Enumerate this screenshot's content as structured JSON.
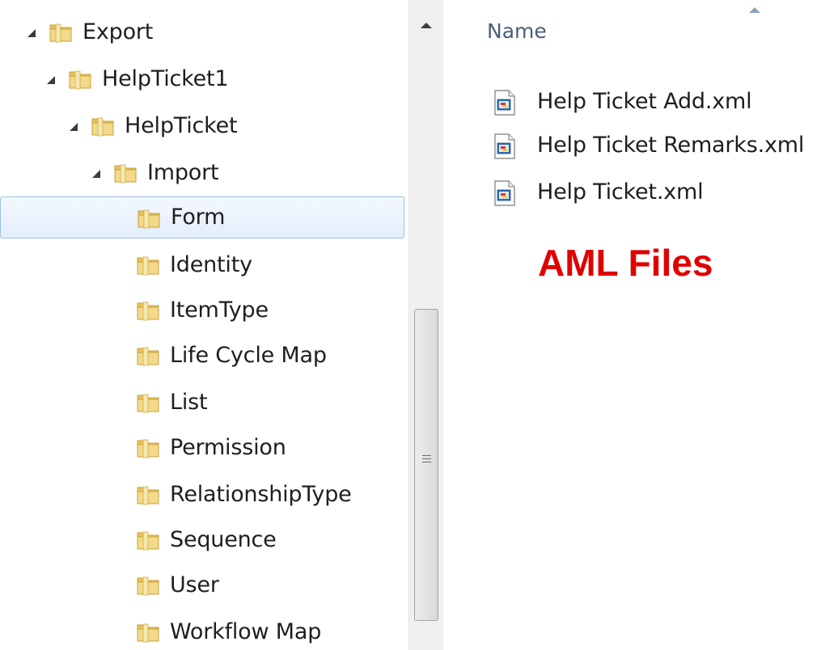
{
  "tree": {
    "items": [
      {
        "label": "Export",
        "expanded": true,
        "selected": false,
        "icon": "folder-icon"
      },
      {
        "label": "HelpTicket1",
        "expanded": true,
        "selected": false,
        "icon": "folder-icon"
      },
      {
        "label": "HelpTicket",
        "expanded": true,
        "selected": false,
        "icon": "folder-icon"
      },
      {
        "label": "Import",
        "expanded": true,
        "selected": false,
        "icon": "folder-icon"
      },
      {
        "label": "Form",
        "expanded": false,
        "selected": true,
        "icon": "folder-icon"
      },
      {
        "label": "Identity",
        "expanded": false,
        "selected": false,
        "icon": "folder-icon"
      },
      {
        "label": "ItemType",
        "expanded": false,
        "selected": false,
        "icon": "folder-icon"
      },
      {
        "label": "Life Cycle Map",
        "expanded": false,
        "selected": false,
        "icon": "folder-icon"
      },
      {
        "label": "List",
        "expanded": false,
        "selected": false,
        "icon": "folder-icon"
      },
      {
        "label": "Permission",
        "expanded": false,
        "selected": false,
        "icon": "folder-icon"
      },
      {
        "label": "RelationshipType",
        "expanded": false,
        "selected": false,
        "icon": "folder-icon"
      },
      {
        "label": "Sequence",
        "expanded": false,
        "selected": false,
        "icon": "folder-icon"
      },
      {
        "label": "User",
        "expanded": false,
        "selected": false,
        "icon": "folder-icon"
      },
      {
        "label": "Workflow Map",
        "expanded": false,
        "selected": false,
        "icon": "folder-icon"
      }
    ]
  },
  "file_list": {
    "column_header": "Name",
    "sort_indicator": "sort-ascending-icon",
    "files": [
      {
        "name": "Help Ticket Add.xml",
        "icon": "xml-file-icon"
      },
      {
        "name": "Help Ticket Remarks.xml",
        "icon": "xml-file-icon"
      },
      {
        "name": "Help Ticket.xml",
        "icon": "xml-file-icon"
      }
    ]
  },
  "annotation": {
    "text": "AML Files",
    "color": "#e00000"
  },
  "colors": {
    "folder": "#e8c35a",
    "selection_border": "#9cc0e6",
    "header_text": "#4a5f7a"
  }
}
